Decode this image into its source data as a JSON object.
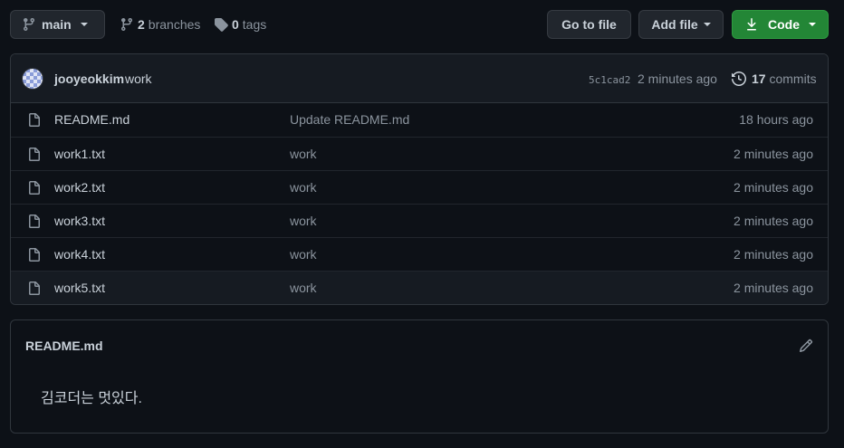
{
  "branch": {
    "name": "main"
  },
  "meta": {
    "branches_count": "2",
    "branches_label": "branches",
    "tags_count": "0",
    "tags_label": "tags"
  },
  "buttons": {
    "go_to_file": "Go to file",
    "add_file": "Add file",
    "code": "Code"
  },
  "commit": {
    "author": "jooyeokkim",
    "message": "work",
    "sha": "5c1cad2",
    "time": "2 minutes ago",
    "count": "17",
    "count_label": "commits"
  },
  "files": [
    {
      "name": "README.md",
      "message": "Update README.md",
      "time": "18 hours ago"
    },
    {
      "name": "work1.txt",
      "message": "work",
      "time": "2 minutes ago"
    },
    {
      "name": "work2.txt",
      "message": "work",
      "time": "2 minutes ago"
    },
    {
      "name": "work3.txt",
      "message": "work",
      "time": "2 minutes ago"
    },
    {
      "name": "work4.txt",
      "message": "work",
      "time": "2 minutes ago"
    },
    {
      "name": "work5.txt",
      "message": "work",
      "time": "2 minutes ago"
    }
  ],
  "readme": {
    "title": "README.md",
    "content": "김코더는 멋있다."
  },
  "colors": {
    "background": "#0d1117",
    "border": "#30363d",
    "code_button": "#238636",
    "muted_text": "#8b949e"
  },
  "icons": {
    "branch": "git-branch-icon",
    "branches": "git-branch-icon",
    "tags": "tag-icon",
    "download": "download-icon",
    "history": "history-icon",
    "file": "file-icon",
    "edit": "pencil-icon"
  }
}
